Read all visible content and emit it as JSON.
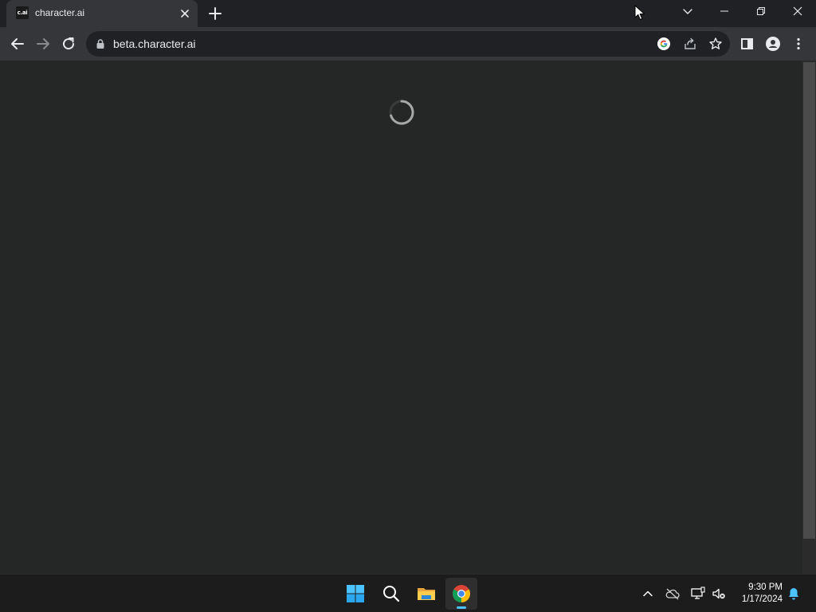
{
  "browser": {
    "tab": {
      "favicon_text": "c.ai",
      "title": "character.ai"
    },
    "address_bar": {
      "url": "beta.character.ai"
    }
  },
  "page": {
    "state": "loading"
  },
  "taskbar": {
    "apps": [
      "start-icon",
      "search-icon",
      "file-explorer-icon",
      "chrome-icon"
    ],
    "active_app": "chrome-icon",
    "clock": {
      "time": "9:30 PM",
      "date": "1/17/2024"
    }
  },
  "colors": {
    "tabstrip_bg": "#202124",
    "toolbar_bg": "#35363a",
    "content_bg": "#252626",
    "taskbar_bg": "#1c1c1c",
    "accent": "#4cc2ff"
  }
}
